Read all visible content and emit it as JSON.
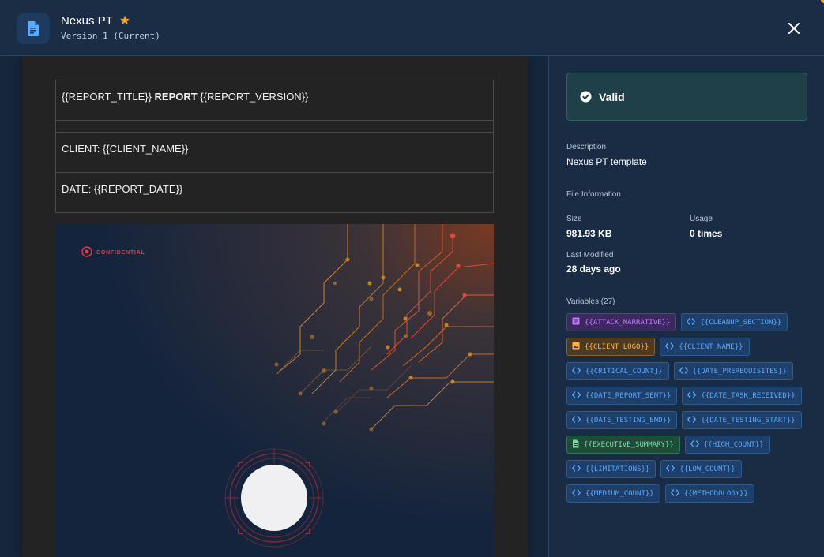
{
  "header": {
    "title": "Nexus PT",
    "version": "Version 1 (Current)"
  },
  "document": {
    "row1_pre": "{{REPORT_TITLE}} ",
    "row1_bold": "REPORT",
    "row1_post": " {{REPORT_VERSION}}",
    "row3": "CLIENT: {{CLIENT_NAME}}",
    "row4": "DATE: {{REPORT_DATE}}",
    "confidential": "CONFIDENTIAL"
  },
  "status": {
    "label": "Valid",
    "color": "#2d6360"
  },
  "details": {
    "description_label": "Description",
    "description": "Nexus PT template",
    "file_info_label": "File Information",
    "size_label": "Size",
    "size": "981.93 KB",
    "usage_label": "Usage",
    "usage": "0 times",
    "modified_label": "Last Modified",
    "modified": "28 days ago",
    "variables_label": "Variables (27)"
  },
  "variables": [
    {
      "name": "{{ATTACK_NARRATIVE}}",
      "kind": "text-block",
      "color": "purple",
      "icon": "document-lines-icon"
    },
    {
      "name": "{{CLEANUP_SECTION}}",
      "kind": "code",
      "color": "blue",
      "icon": "code-icon"
    },
    {
      "name": "{{CLIENT_LOGO}}",
      "kind": "image",
      "color": "orange",
      "icon": "image-icon"
    },
    {
      "name": "{{CLIENT_NAME}}",
      "kind": "code",
      "color": "blue",
      "icon": "code-icon"
    },
    {
      "name": "{{CRITICAL_COUNT}}",
      "kind": "code",
      "color": "blue",
      "icon": "code-icon"
    },
    {
      "name": "{{DATE_PREREQUISITES}}",
      "kind": "code",
      "color": "blue",
      "icon": "code-icon"
    },
    {
      "name": "{{DATE_REPORT_SENT}}",
      "kind": "code",
      "color": "blue",
      "icon": "code-icon"
    },
    {
      "name": "{{DATE_TASK_RECEIVED}}",
      "kind": "code",
      "color": "blue",
      "icon": "code-icon"
    },
    {
      "name": "{{DATE_TESTING_END}}",
      "kind": "code",
      "color": "blue",
      "icon": "code-icon"
    },
    {
      "name": "{{DATE_TESTING_START}}",
      "kind": "code",
      "color": "blue",
      "icon": "code-icon"
    },
    {
      "name": "{{EXECUTIVE_SUMMARY}}",
      "kind": "document",
      "color": "green",
      "icon": "document-icon"
    },
    {
      "name": "{{HIGH_COUNT}}",
      "kind": "code",
      "color": "blue",
      "icon": "code-icon"
    },
    {
      "name": "{{LIMITATIONS}}",
      "kind": "code",
      "color": "blue",
      "icon": "code-icon"
    },
    {
      "name": "{{LOW_COUNT}}",
      "kind": "code",
      "color": "blue",
      "icon": "code-icon"
    },
    {
      "name": "{{MEDIUM_COUNT}}",
      "kind": "code",
      "color": "blue",
      "icon": "code-icon"
    },
    {
      "name": "{{METHODOLOGY}}",
      "kind": "code",
      "color": "blue",
      "icon": "code-icon"
    }
  ],
  "colors": {
    "accent": "#5aa8ff",
    "star": "#f5a623",
    "background": "#1a2c44"
  }
}
